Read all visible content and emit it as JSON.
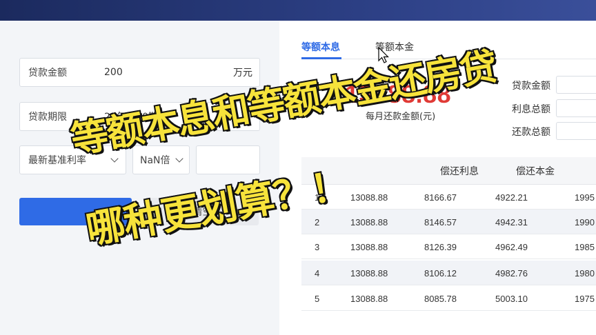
{
  "form": {
    "loan_amount": {
      "label": "贷款金额",
      "value": "200",
      "unit": "万元"
    },
    "loan_term": {
      "label": "贷款期限",
      "value": "20年(240期)"
    },
    "rate_type": {
      "value": "最新基准利率"
    },
    "rate_multiplier": {
      "value": "NaN倍"
    },
    "clear_label": "清空"
  },
  "tabs": [
    {
      "label": "等额本息",
      "active": true
    },
    {
      "label": "等额本金",
      "active": false
    }
  ],
  "summary": {
    "monthly_payment": "13088.88",
    "monthly_payment_label": "每月还款金额(元)",
    "loan_amount_label": "贷款金额",
    "interest_total_label": "利息总额",
    "repay_total_label": "还款总额"
  },
  "table": {
    "headers": [
      "偿还利息",
      "偿还本金"
    ],
    "rows": [
      [
        "1",
        "13088.88",
        "8166.67",
        "4922.21",
        "1995"
      ],
      [
        "2",
        "13088.88",
        "8146.57",
        "4942.31",
        "1990"
      ],
      [
        "3",
        "13088.88",
        "8126.39",
        "4962.49",
        "1985"
      ],
      [
        "4",
        "13088.88",
        "8106.12",
        "4982.76",
        "1980"
      ],
      [
        "5",
        "13088.88",
        "8085.78",
        "5003.10",
        "1975"
      ]
    ]
  },
  "overlay": {
    "line1": "等额本息和等额本金还房贷",
    "line2": "哪种更划算？！"
  },
  "colors": {
    "accent": "#2f6be6",
    "highlight": "#e03a36",
    "overlay_text": "#f7e33b"
  }
}
